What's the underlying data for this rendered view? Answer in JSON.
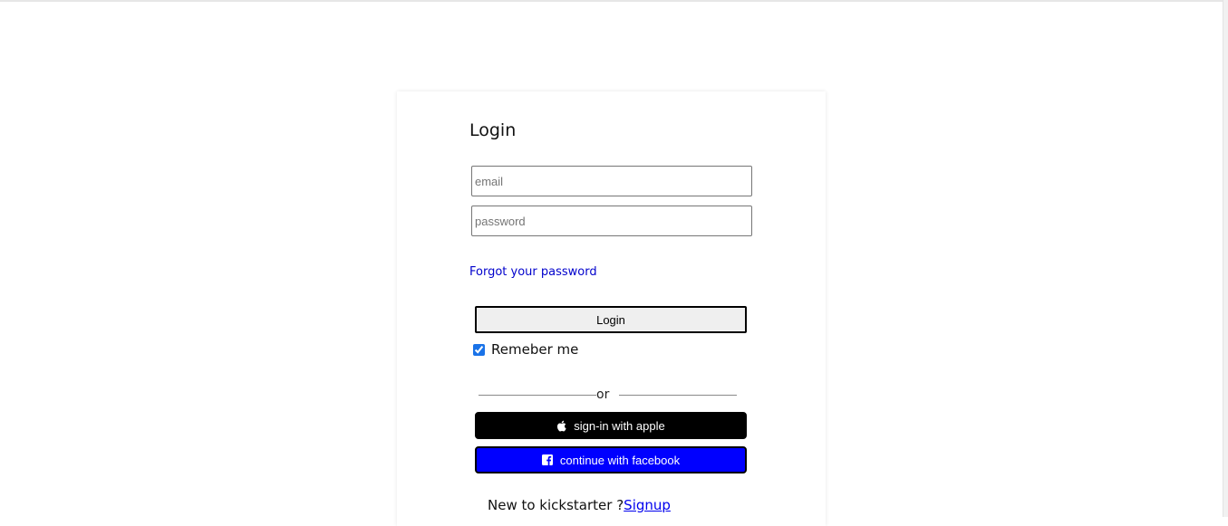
{
  "login": {
    "title": "Login",
    "email_placeholder": "email",
    "password_placeholder": "password",
    "forgot_password": "Forgot your password",
    "login_button": "Login",
    "remember_me": "Remeber me",
    "remember_checked": true,
    "or_text": "or",
    "apple_button": "sign-in with apple",
    "apple_icon": "apple-icon",
    "facebook_button": "continue with facebook",
    "facebook_icon": "facebook-icon",
    "new_user_text": "New to kickstarter ?",
    "signup_link": "Signup"
  },
  "colors": {
    "apple_button_bg": "#000000",
    "facebook_button_bg": "#0000ff",
    "link": "#0000cc"
  }
}
